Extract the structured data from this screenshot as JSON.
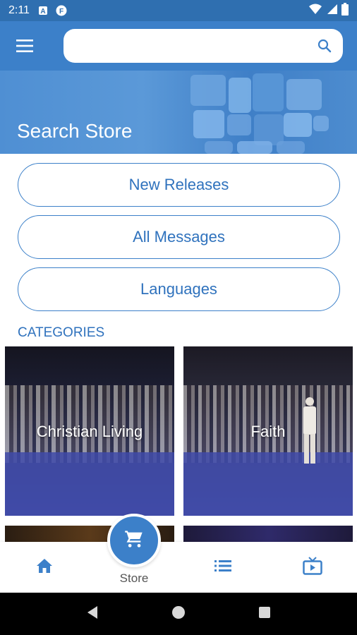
{
  "status_bar": {
    "time": "2:11",
    "icons_left": [
      "a-box-icon",
      "f-circle-icon"
    ],
    "icons_right": [
      "wifi-icon",
      "signal-icon",
      "battery-icon"
    ]
  },
  "app_bar": {
    "menu_icon": "hamburger-menu-icon",
    "search": {
      "placeholder": "",
      "value": ""
    },
    "search_icon": "search-icon"
  },
  "hero": {
    "title": "Search Store"
  },
  "buttons": {
    "new_releases": "New Releases",
    "all_messages": "All Messages",
    "languages": "Languages"
  },
  "categories": {
    "title": "CATEGORIES",
    "items": [
      {
        "label": "Christian Living"
      },
      {
        "label": "Faith"
      }
    ]
  },
  "bottom_nav": {
    "home_icon": "home-icon",
    "store_icon": "shopping-cart-icon",
    "store_label": "Store",
    "list_icon": "list-icon",
    "tv_icon": "tv-play-icon"
  },
  "colors": {
    "primary": "#3c80c9",
    "status_bar": "#2f6fb0",
    "accent_text": "#2f72bd"
  }
}
